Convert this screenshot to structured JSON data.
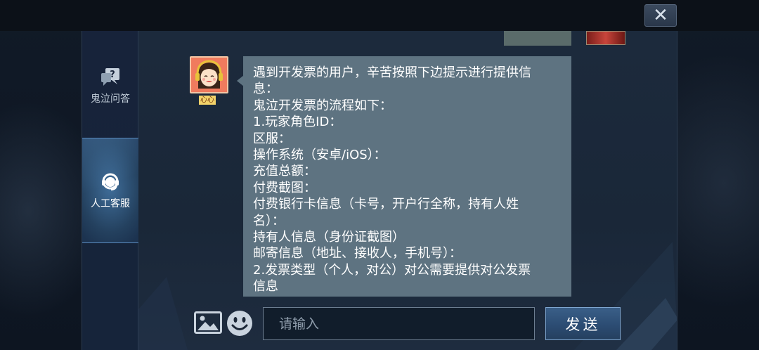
{
  "window": {
    "close_symbol": "✕"
  },
  "sidebar": {
    "items": [
      {
        "label": "鬼泣问答",
        "icon": "question-chat-icon",
        "active": false
      },
      {
        "label": "人工客服",
        "icon": "headset-icon",
        "active": true
      }
    ]
  },
  "chat": {
    "agent_name": "心心",
    "agent_avatar": "girl-headset-avatar",
    "message_lines": [
      "遇到开发票的用户，辛苦按照下边提示进行提供信",
      "息：",
      "鬼泣开发票的流程如下：",
      "1.玩家角色ID：",
      "区服：",
      "操作系统（安卓/iOS）：",
      "充值总额：",
      "付费截图：",
      "付费银行卡信息（卡号，开户行全称，持有人姓",
      "名）：",
      "持有人信息（身份证截图）",
      "邮寄信息（地址、接收人，手机号）：",
      "2.发票类型（个人，对公）对公需要提供对公发票",
      "信息"
    ]
  },
  "input_bar": {
    "image_button_icon": "image-icon",
    "emoji_button_icon": "emoji-icon",
    "placeholder": "请输入",
    "send_label": "发送"
  },
  "colors": {
    "bubble": "#5e7381",
    "panel": "#1c2a3c",
    "send_button": "#2c4c73",
    "avatar_bg": "#f07b5e"
  }
}
